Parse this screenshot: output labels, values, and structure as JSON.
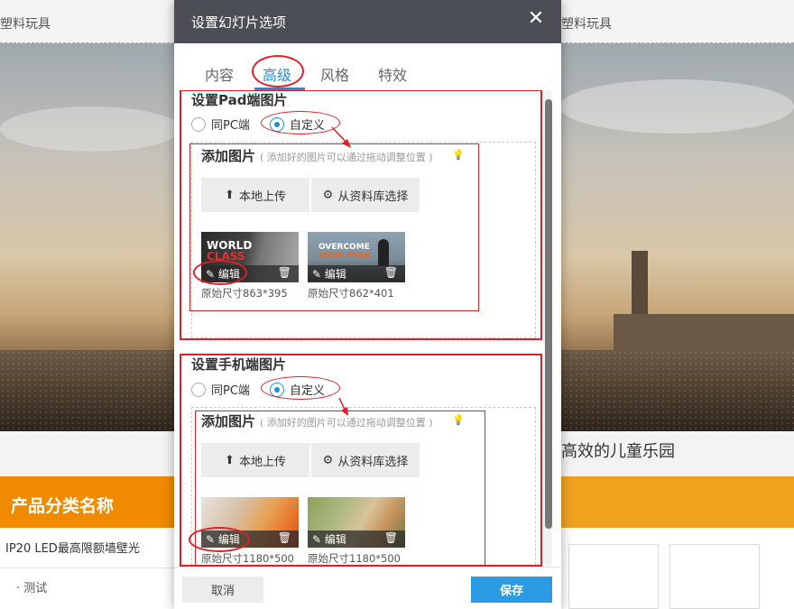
{
  "background": {
    "topbar_left": "塑料玩具",
    "topbar_right": "塑料玩具",
    "slogan": "高效的儿童乐园",
    "category_title": "产品分类名称",
    "list_items": [
      "IP20 LED最高限额墙壁光",
      "· 测试"
    ]
  },
  "modal": {
    "title": "设置幻灯片选项",
    "close_icon": "close-icon",
    "tabs": [
      {
        "label": "内容",
        "active": false
      },
      {
        "label": "高级",
        "active": true
      },
      {
        "label": "风格",
        "active": false
      },
      {
        "label": "特效",
        "active": false
      }
    ],
    "pad": {
      "title": "设置Pad端图片",
      "radio_same": "同PC端",
      "radio_custom": "自定义",
      "selected": "自定义",
      "add_title": "添加图片",
      "add_hint": "( 添加好的图片可以通过拖动调整位置 )",
      "upload_label": "本地上传",
      "library_label": "从资料库选择",
      "images": [
        {
          "index": "1",
          "text1": "WORLD",
          "text2": "CLASS",
          "edit_label": "编辑",
          "size_label": "原始尺寸863*395"
        },
        {
          "index": "2",
          "text1": "OVERCOME",
          "text2": "YOUR FEAR",
          "edit_label": "编辑",
          "size_label": "原始尺寸862*401"
        }
      ]
    },
    "mobile": {
      "title": "设置手机端图片",
      "radio_same": "同PC端",
      "radio_custom": "自定义",
      "selected": "自定义",
      "add_title": "添加图片",
      "add_hint": "( 添加好的图片可以通过拖动调整位置 )",
      "upload_label": "本地上传",
      "library_label": "从资料库选择",
      "images": [
        {
          "index": "1",
          "edit_label": "编辑",
          "size_label": "原始尺寸1180*500"
        },
        {
          "index": "2",
          "edit_label": "编辑",
          "size_label": "原始尺寸1180*500"
        }
      ]
    },
    "footer": {
      "cancel_label": "取消",
      "save_label": "保存"
    }
  },
  "colors": {
    "accent": "#1b8fd4",
    "save_button": "#2b9be3",
    "header": "#4b4f55",
    "annotation_red": "#e41e26",
    "category_orange": "#f08a00"
  }
}
